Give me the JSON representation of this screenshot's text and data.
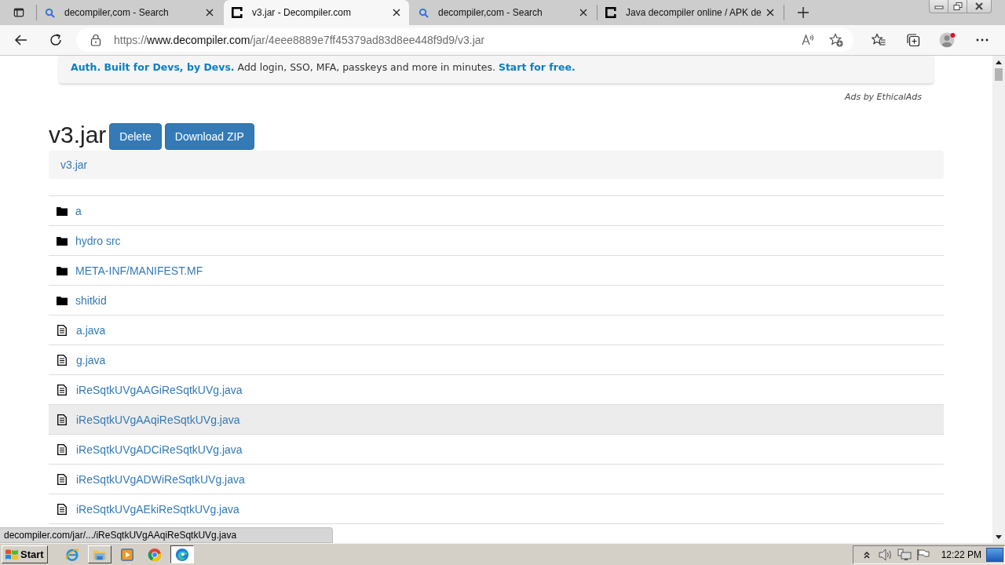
{
  "browser": {
    "tabs": [
      {
        "title": "decompiler,com - Search",
        "kind": "search",
        "selected": false
      },
      {
        "title": "v3.jar - Decompiler.com",
        "kind": "site",
        "selected": true
      },
      {
        "title": "decompiler,com - Search",
        "kind": "search",
        "selected": false
      },
      {
        "title": "Java decompiler online / APK de",
        "kind": "site",
        "selected": false
      }
    ],
    "address": {
      "scheme": "https://",
      "host": "www.decompiler.com",
      "path": "/jar/4eee8889e7ff45379ad83d8ee448f9d9/v3.jar"
    }
  },
  "ad": {
    "parts": [
      {
        "kind": "link",
        "text": "Auth. Built for Devs, by Devs."
      },
      {
        "kind": "text",
        "text": "Add login, SSO, MFA, passkeys and more in minutes."
      },
      {
        "kind": "link",
        "text": "Start for free."
      }
    ],
    "credit": "Ads by EthicalAds"
  },
  "page": {
    "title": "v3.jar",
    "actions": [
      "Delete",
      "Download ZIP"
    ],
    "breadcrumb": [
      "v3.jar"
    ],
    "entries": [
      {
        "name": "a",
        "kind": "folder",
        "hovered": false
      },
      {
        "name": "hydro src",
        "kind": "folder",
        "hovered": false
      },
      {
        "name": "META-INF/MANIFEST.MF",
        "kind": "folder",
        "hovered": false
      },
      {
        "name": "shitkid",
        "kind": "folder",
        "hovered": false
      },
      {
        "name": "a.java",
        "kind": "file",
        "hovered": false
      },
      {
        "name": "g.java",
        "kind": "file",
        "hovered": false
      },
      {
        "name": "iReSqtkUVgAAGiReSqtkUVg.java",
        "kind": "file",
        "hovered": false
      },
      {
        "name": "iReSqtkUVgAAqiReSqtkUVg.java",
        "kind": "file",
        "hovered": true
      },
      {
        "name": "iReSqtkUVgADCiReSqtkUVg.java",
        "kind": "file",
        "hovered": false
      },
      {
        "name": "iReSqtkUVgADWiReSqtkUVg.java",
        "kind": "file",
        "hovered": false
      },
      {
        "name": "iReSqtkUVgAEkiReSqtkUVg.java",
        "kind": "file",
        "hovered": false
      }
    ]
  },
  "status_link": "decompiler.com/jar/.../iReSqtkUVgAAqiReSqtkUVg.java",
  "taskbar": {
    "start": "Start",
    "apps": [
      {
        "kind": "ie",
        "running": false,
        "selected": false
      },
      {
        "kind": "explorer",
        "running": true,
        "selected": false
      },
      {
        "kind": "media",
        "running": false,
        "selected": false
      },
      {
        "kind": "chrome",
        "running": false,
        "selected": false
      },
      {
        "kind": "edge",
        "running": true,
        "selected": true
      }
    ],
    "clock": "12:22 PM"
  }
}
